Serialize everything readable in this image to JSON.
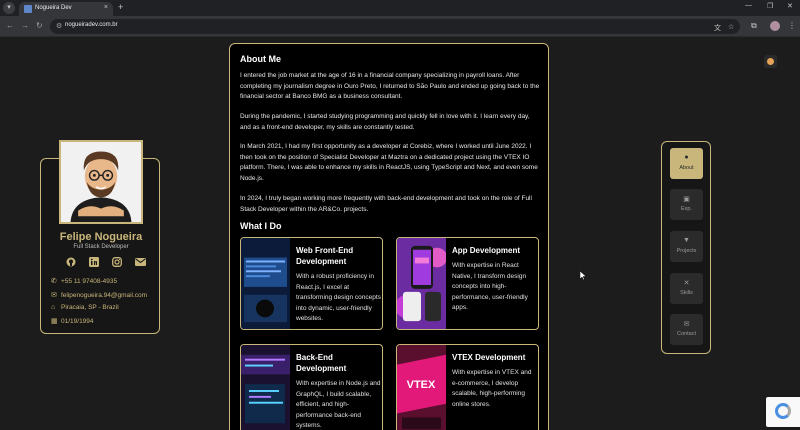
{
  "browser": {
    "tab_title": "Nogueira Dev",
    "tab_close": "×",
    "new_tab": "+",
    "url": "nogueiradev.com.br",
    "window_minimize": "—",
    "window_restore": "❐",
    "window_close": "✕"
  },
  "profile": {
    "name": "Felipe Nogueira",
    "role": "Full Stack Developer",
    "socials": [
      "github-icon",
      "linkedin-icon",
      "instagram-icon",
      "mail-icon"
    ],
    "contacts": [
      {
        "icon": "phone-icon",
        "glyph": "✆",
        "text": "+55 11 97408-4935"
      },
      {
        "icon": "envelope-icon",
        "glyph": "✉",
        "text": "felipenogueira.94@gmail.com"
      },
      {
        "icon": "location-icon",
        "glyph": "⌂",
        "text": "Piracaia, SP - Brazil"
      },
      {
        "icon": "calendar-icon",
        "glyph": "▦",
        "text": "01/19/1994"
      }
    ]
  },
  "about": {
    "title": "About Me",
    "paragraphs": [
      "I entered the job market at the age of 16 in a financial company specializing in payroll loans. After completing my journalism degree in Ouro Preto, I returned to São Paulo and ended up going back to the financial sector at Banco BMG as a business consultant.",
      "During the pandemic, I started studying programming and quickly fell in love with it. I learn every day, and as a front-end developer, my skills are constantly tested.",
      "In March 2021, I had my first opportunity as a developer at Corebiz, where I worked until June 2022. I then took on the position of Specialist Developer at Maztra on a dedicated project using the VTEX IO platform. There, I was able to enhance my skills in ReactJS, using TypeScript and Next, and even some Node.js.",
      "In 2024, I truly began working more frequently with back-end development and took on the role of Full Stack Developer within the AR&Co. projects."
    ]
  },
  "what_i_do": {
    "title": "What I Do",
    "items": [
      {
        "title": "Web Front-End Development",
        "desc": "With a robust proficiency in React.js, I excel at transforming design concepts into dynamic, user-friendly websites."
      },
      {
        "title": "App Development",
        "desc": "With expertise in React Native, I transform design concepts into high-performance, user-friendly apps."
      },
      {
        "title": "Back-End Development",
        "desc": "With expertise in Node.js and GraphQL, I build scalable, efficient, and high-performance back-end systems."
      },
      {
        "title": "VTEX Development",
        "desc": "With expertise in VTEX and e-commerce, I develop scalable, high-performing online stores."
      }
    ],
    "vtex_logo": "VTEX"
  },
  "nav": [
    {
      "label": "About",
      "icon": "user-icon",
      "glyph": "●",
      "active": true
    },
    {
      "label": "Exp.",
      "icon": "briefcase-icon",
      "glyph": "▣",
      "active": false
    },
    {
      "label": "Projects",
      "icon": "filter-icon",
      "glyph": "▼",
      "active": false
    },
    {
      "label": "Skills",
      "icon": "tools-icon",
      "glyph": "✕",
      "active": false
    },
    {
      "label": "Contact",
      "icon": "envelope-icon",
      "glyph": "✉",
      "active": false
    }
  ]
}
